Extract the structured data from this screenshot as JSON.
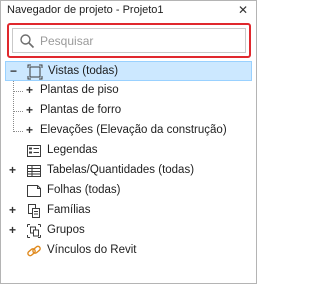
{
  "panel": {
    "title": "Navegador de projeto - Projeto1",
    "close_label": "✕"
  },
  "search": {
    "placeholder": "Pesquisar",
    "value": "",
    "highlight_color": "#e0282d"
  },
  "tree": {
    "selection_color": "#cce8ff",
    "items": [
      {
        "label": "Vistas (todas)",
        "expander": "−",
        "icon": "views-icon",
        "selected": true
      },
      {
        "label": "Plantas de piso",
        "expander": "+",
        "icon": "",
        "selected": false
      },
      {
        "label": "Plantas de forro",
        "expander": "+",
        "icon": "",
        "selected": false
      },
      {
        "label": "Elevações (Elevação da construção)",
        "expander": "+",
        "icon": "",
        "selected": false
      },
      {
        "label": "Legendas",
        "expander": "",
        "icon": "legends-icon",
        "selected": false
      },
      {
        "label": "Tabelas/Quantidades (todas)",
        "expander": "+",
        "icon": "schedules-icon",
        "selected": false
      },
      {
        "label": "Folhas (todas)",
        "expander": "",
        "icon": "sheets-icon",
        "selected": false
      },
      {
        "label": "Famílias",
        "expander": "+",
        "icon": "families-icon",
        "selected": false
      },
      {
        "label": "Grupos",
        "expander": "+",
        "icon": "groups-icon",
        "selected": false
      },
      {
        "label": "Vínculos do Revit",
        "expander": "",
        "icon": "revit-links-icon",
        "selected": false
      }
    ]
  }
}
